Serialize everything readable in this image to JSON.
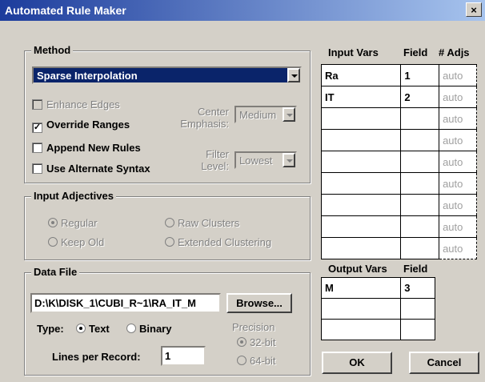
{
  "window": {
    "title": "Automated Rule Maker",
    "close": "×"
  },
  "method": {
    "label": "Method",
    "selected": "Sparse Interpolation",
    "enhance_edges": "Enhance Edges",
    "override_ranges": "Override Ranges",
    "append_new_rules": "Append New Rules",
    "use_alternate_syntax": "Use Alternate Syntax",
    "center_label_1": "Center",
    "center_label_2": "Emphasis:",
    "center_value": "Medium",
    "filter_label_1": "Filter",
    "filter_label_2": "Level:",
    "filter_value": "Lowest"
  },
  "input_adjectives": {
    "label": "Input Adjectives",
    "regular": "Regular",
    "raw_clusters": "Raw Clusters",
    "keep_old": "Keep Old",
    "extended_clustering": "Extended Clustering"
  },
  "data_file": {
    "label": "Data File",
    "path": "D:\\K\\DISK_1\\CUBI_R~1\\RA_IT_M",
    "browse": "Browse...",
    "type_label": "Type:",
    "text": "Text",
    "binary": "Binary",
    "precision": "Precision",
    "bit32": "32-bit",
    "bit64": "64-bit",
    "lines_label": "Lines per Record:",
    "lines_value": "1"
  },
  "input_vars": {
    "headers": [
      "Input Vars",
      "Field",
      "# Adjs"
    ],
    "rows": [
      [
        "Ra",
        "1",
        "auto"
      ],
      [
        "IT",
        "2",
        "auto"
      ],
      [
        "",
        "",
        "auto"
      ],
      [
        "",
        "",
        "auto"
      ],
      [
        "",
        "",
        "auto"
      ],
      [
        "",
        "",
        "auto"
      ],
      [
        "",
        "",
        "auto"
      ],
      [
        "",
        "",
        "auto"
      ],
      [
        "",
        "",
        "auto"
      ]
    ]
  },
  "output_vars": {
    "headers": [
      "Output Vars",
      "Field"
    ],
    "rows": [
      [
        "M",
        "3"
      ],
      [
        "",
        ""
      ],
      [
        "",
        ""
      ]
    ]
  },
  "buttons": {
    "ok": "OK",
    "cancel": "Cancel"
  }
}
